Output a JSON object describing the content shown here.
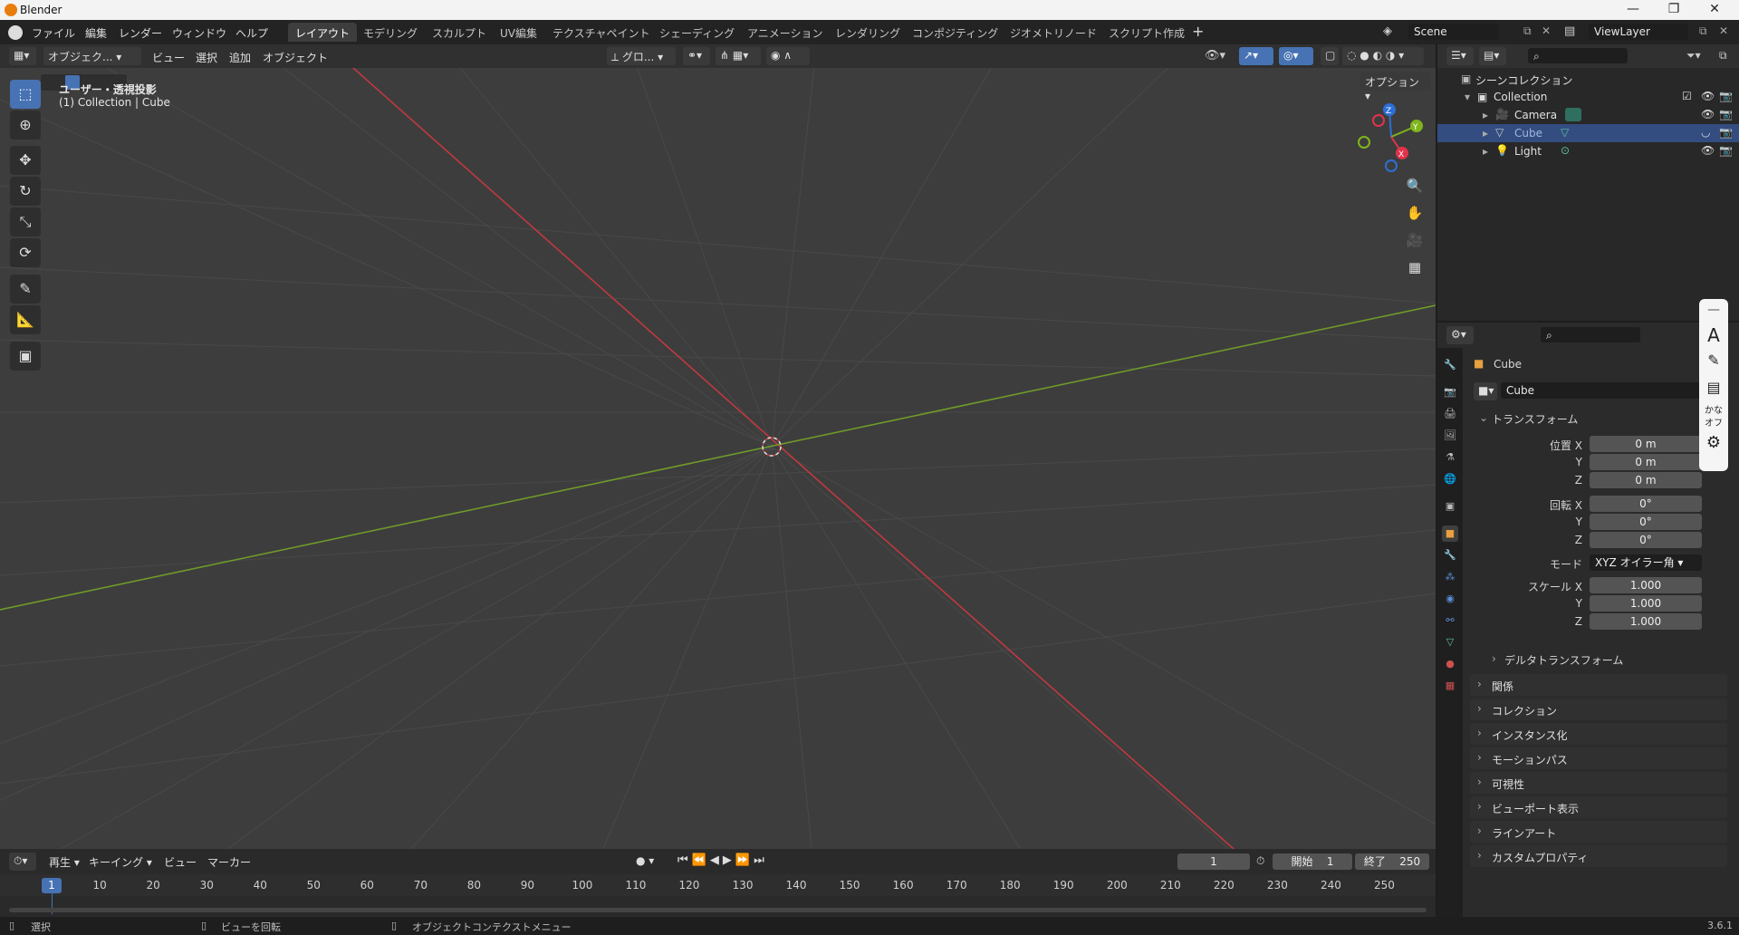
{
  "window": {
    "title": "Blender"
  },
  "menu": [
    "ファイル",
    "編集",
    "レンダー",
    "ウィンドウ",
    "ヘルプ"
  ],
  "workspaces": [
    "レイアウト",
    "モデリング",
    "スカルプト",
    "UV編集",
    "テクスチャペイント",
    "シェーディング",
    "アニメーション",
    "レンダリング",
    "コンポジティング",
    "ジオメトリノード",
    "スクリプト作成"
  ],
  "scene": {
    "name": "Scene",
    "view_layer": "ViewLayer"
  },
  "viewport": {
    "mode": "オブジェク...",
    "menus": [
      "ビュー",
      "選択",
      "追加",
      "オブジェクト"
    ],
    "transform_orient": "グロ...",
    "options": "オプション",
    "overlay_line1": "ユーザー・透視投影",
    "overlay_line2": "(1) Collection | Cube",
    "gizmo": {
      "x": "X",
      "y": "Y",
      "z": "Z"
    }
  },
  "outliner": {
    "root": "シーンコレクション",
    "collection": "Collection",
    "items": [
      {
        "name": "Camera",
        "selected": false
      },
      {
        "name": "Cube",
        "selected": true
      },
      {
        "name": "Light",
        "selected": false
      }
    ]
  },
  "properties": {
    "object_name": "Cube",
    "datablock": "Cube",
    "transform_label": "トランスフォーム",
    "location_label": "位置 X",
    "rotation_label": "回転 X",
    "scale_label": "スケール X",
    "y_label": "Y",
    "z_label": "Z",
    "location": [
      "0 m",
      "0 m",
      "0 m"
    ],
    "rotation": [
      "0°",
      "0°",
      "0°"
    ],
    "mode_label": "モード",
    "mode_value": "XYZ オイラー角",
    "scale": [
      "1.000",
      "1.000",
      "1.000"
    ],
    "delta": "デルタトランスフォーム",
    "panels": [
      "関係",
      "コレクション",
      "インスタンス化",
      "モーションパス",
      "可視性",
      "ビューポート表示",
      "ラインアート",
      "カスタムプロパティ"
    ]
  },
  "timeline": {
    "menus": [
      "再生",
      "キーイング",
      "ビュー",
      "マーカー"
    ],
    "current_frame": "1",
    "start_label": "開始",
    "start": "1",
    "end_label": "終了",
    "end": "250",
    "ticks": [
      "1",
      "10",
      "20",
      "30",
      "40",
      "50",
      "60",
      "70",
      "80",
      "90",
      "100",
      "110",
      "120",
      "130",
      "140",
      "150",
      "160",
      "170",
      "180",
      "190",
      "200",
      "210",
      "220",
      "230",
      "240",
      "250"
    ]
  },
  "status": {
    "select": "選択",
    "rotate": "ビューを回転",
    "context": "オブジェクトコンテクストメニュー",
    "version": "3.6.1"
  },
  "ime": {
    "mode_a": "A",
    "kana": "かな",
    "off": "オフ"
  }
}
